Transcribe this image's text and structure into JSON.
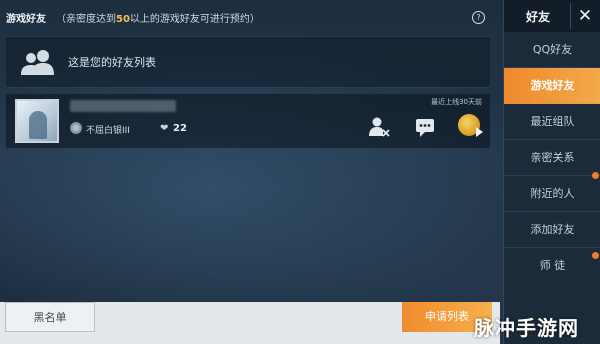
{
  "header": {
    "title": "游戏好友",
    "notice_prefix": "（亲密度达到",
    "notice_highlight": "50",
    "notice_suffix": "以上的游戏好友可进行预约）",
    "help_icon": "question-circle-icon"
  },
  "banner": {
    "icon": "friends-group-icon",
    "text": "这是您的好友列表"
  },
  "friend": {
    "rank": "不屈白银III",
    "intimacy": "22",
    "last_online": "最近上线30天前",
    "actions": [
      "remove-friend-icon",
      "chat-icon",
      "gift-icon"
    ]
  },
  "bottom": {
    "blacklist_label": "黑名单",
    "apply_label": "申请列表"
  },
  "sidebar": {
    "title": "好友",
    "close_label": "✕",
    "items": [
      {
        "label": "QQ好友"
      },
      {
        "label": "游戏好友"
      },
      {
        "label": "最近组队"
      },
      {
        "label": "亲密关系"
      },
      {
        "label": "附近的人"
      },
      {
        "label": "添加好友"
      },
      {
        "label": "师 徒"
      }
    ],
    "active_index": 1
  },
  "watermark": "脉冲手游网",
  "colors": {
    "accent": "#f09a38",
    "dot": "#ef7c2a",
    "highlight": "#f5c04a"
  }
}
